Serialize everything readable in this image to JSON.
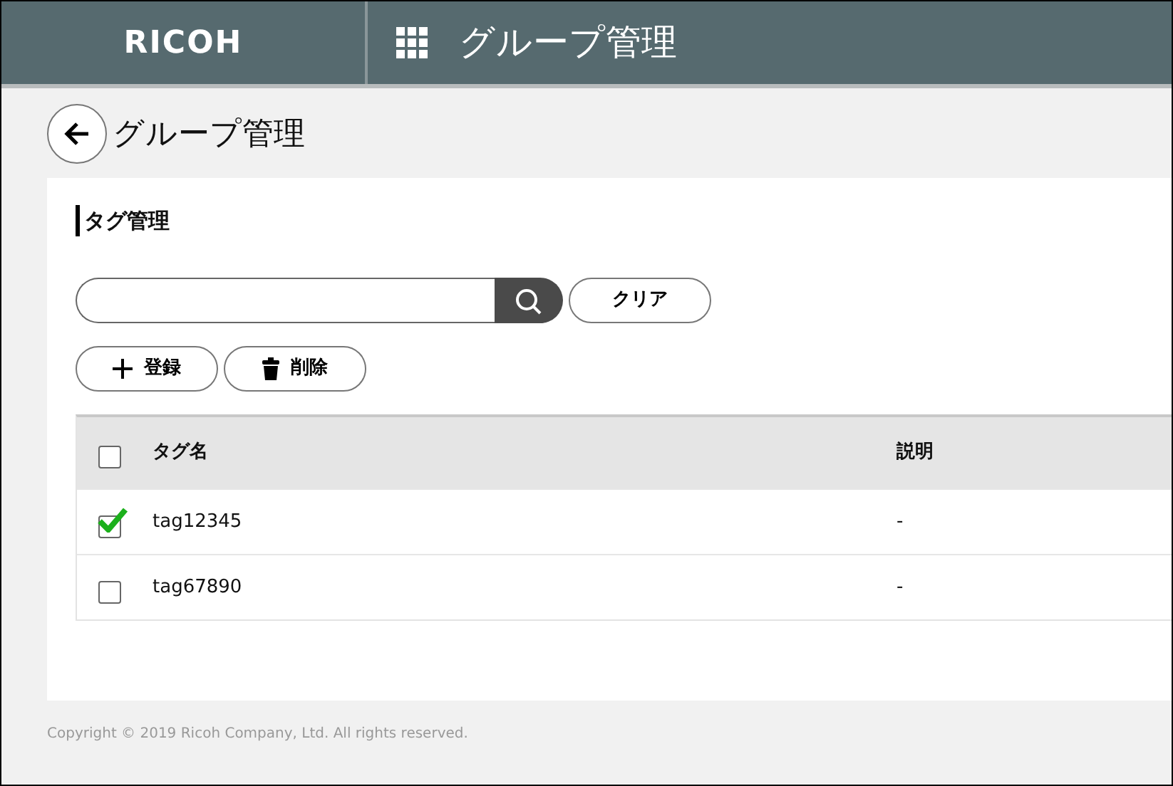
{
  "header": {
    "logo": "RICOH",
    "title": "グループ管理"
  },
  "page": {
    "title": "グループ管理"
  },
  "section": {
    "title": "タグ管理"
  },
  "search": {
    "clear_button": "クリア"
  },
  "actions": [
    {
      "kind": "add",
      "label": "登録"
    },
    {
      "kind": "delete",
      "label": "削除"
    }
  ],
  "table": {
    "select_all": {
      "checked": false
    },
    "columns": [
      "タグ名",
      "説明"
    ],
    "rows": [
      {
        "checked": true,
        "cells": [
          "tag12345",
          "-"
        ]
      },
      {
        "checked": false,
        "cells": [
          "tag67890",
          "-"
        ]
      }
    ]
  },
  "footer": "Copyright © 2019 Ricoh Company, Ltd. All rights reserved."
}
